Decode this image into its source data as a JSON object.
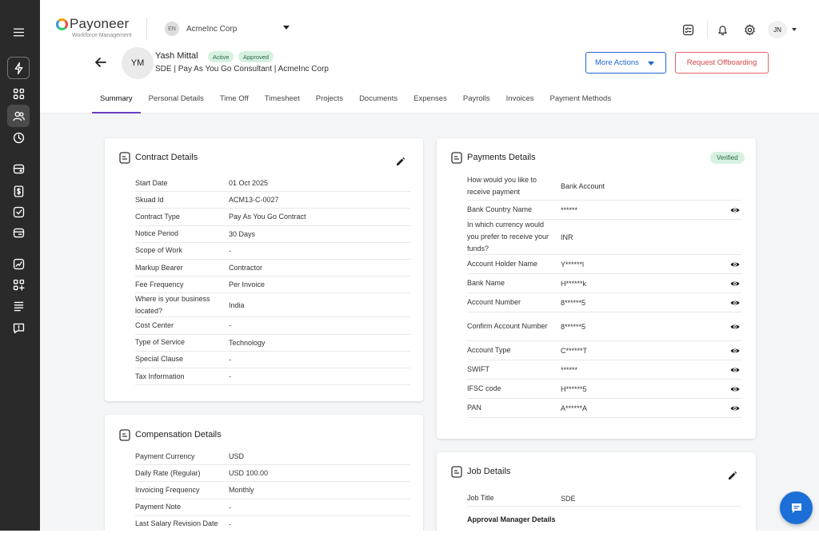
{
  "brand": {
    "name": "Payoneer",
    "sub": "Workforce Management"
  },
  "org": {
    "avatar": "EN",
    "name": "AcmeInc Corp"
  },
  "user": {
    "initials": "JN"
  },
  "employee": {
    "initials": "YM",
    "name": "Yash Mittal",
    "badges": [
      "Active",
      "Approved"
    ],
    "subtitle": "SDE | Pay As You Go Consultant | AcmeInc Corp"
  },
  "actions": {
    "more": "More Actions",
    "offboard": "Request Offboarding"
  },
  "tabs": [
    "Summary",
    "Personal Details",
    "Time Off",
    "Timesheet",
    "Projects",
    "Documents",
    "Expenses",
    "Payrolls",
    "Invoices",
    "Payment Methods"
  ],
  "contract": {
    "title": "Contract Details",
    "rows": [
      {
        "label": "Start Date",
        "value": "01 Oct 2025"
      },
      {
        "label": "Skuad Id",
        "value": "ACM13-C-0027"
      },
      {
        "label": "Contract Type",
        "value": "Pay As You Go Contract"
      },
      {
        "label": "Notice Period",
        "value": "30 Days"
      },
      {
        "label": "Scope of Work",
        "value": "-"
      },
      {
        "label": "Markup Bearer",
        "value": "Contractor"
      },
      {
        "label": "Fee Frequency",
        "value": "Per Invoice"
      },
      {
        "label": "Where is your business located?",
        "value": "India"
      },
      {
        "label": "Cost Center",
        "value": "-"
      },
      {
        "label": "Type of Service",
        "value": "Technology"
      },
      {
        "label": "Special Clause",
        "value": "-"
      },
      {
        "label": "Tax Information",
        "value": "-"
      }
    ]
  },
  "compensation": {
    "title": "Compensation Details",
    "rows": [
      {
        "label": "Payment Currency",
        "value": "USD"
      },
      {
        "label": "Daily Rate (Regular)",
        "value": "USD 100.00"
      },
      {
        "label": "Invoicing Frequency",
        "value": "Monthly"
      },
      {
        "label": "Payment Note",
        "value": "-"
      },
      {
        "label": "Last Salary Revision Date",
        "value": "-"
      }
    ]
  },
  "payments": {
    "title": "Payments Details",
    "status": "Verified",
    "rows": [
      {
        "label": "How would you like to receive payment",
        "value": "Bank Account",
        "eye": false
      },
      {
        "label": "Bank Country Name",
        "value": "******",
        "eye": true
      },
      {
        "label": "In which currency would you prefer to receive your funds?",
        "value": "INR",
        "eye": false
      },
      {
        "label": "Account Holder Name",
        "value": "Y******l",
        "eye": true
      },
      {
        "label": "Bank Name",
        "value": "H******k",
        "eye": true
      },
      {
        "label": "Account Number",
        "value": "8******5",
        "eye": true
      },
      {
        "label": "Confirm Account Number",
        "value": "8******5",
        "eye": true
      },
      {
        "label": "Account Type",
        "value": "C******T",
        "eye": true
      },
      {
        "label": "SWIFT",
        "value": "******",
        "eye": true
      },
      {
        "label": "IFSC code",
        "value": "H******5",
        "eye": true
      },
      {
        "label": "PAN",
        "value": "A******A",
        "eye": true
      }
    ]
  },
  "job": {
    "title": "Job Details",
    "rows": [
      {
        "label": "Job Title",
        "value": "SDE"
      }
    ],
    "section": "Approval Manager Details"
  }
}
